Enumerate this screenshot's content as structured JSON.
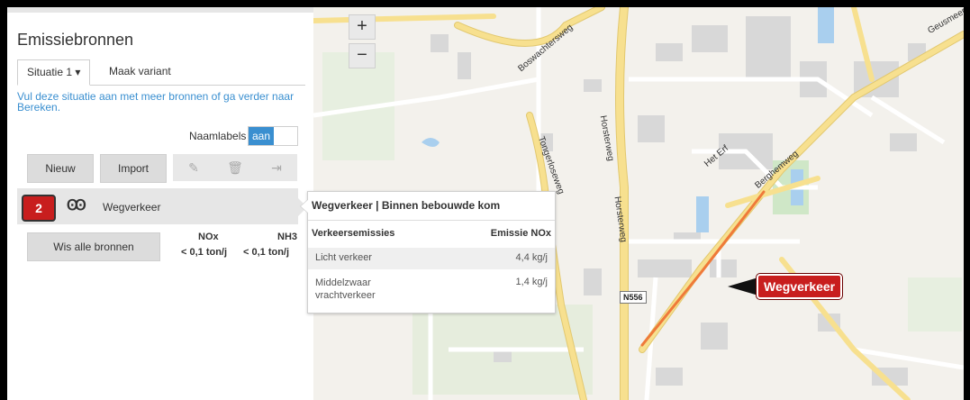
{
  "panel": {
    "title": "Emissiebronnen",
    "tabs": {
      "active": "Situatie 1 ▾",
      "other": "Maak variant"
    },
    "info": "Vul deze situatie aan met meer bronnen of ga verder naar Bereken.",
    "naamlabels": {
      "label": "Naamlabels",
      "toggle": "aan"
    },
    "buttons": {
      "new": "Nieuw",
      "import": "Import",
      "clear_all": "Wis alle bronnen"
    },
    "icons": {
      "edit": "pencil-icon",
      "delete": "trash-icon",
      "copy": "copy-icon"
    },
    "source": {
      "count": "2",
      "icon": "traffic-light-icon",
      "name": "Wegverkeer"
    },
    "totals": {
      "h_nox": "NOx",
      "h_nh3": "NH3",
      "v_nox": "< 0,1 ton/j",
      "v_nh3": "< 0,1 ton/j"
    }
  },
  "popup": {
    "title": "Wegverkeer | Binnen bebouwde kom",
    "col1": "Verkeersemissies",
    "col2": "Emissie NOx",
    "rows": [
      {
        "label": "Licht verkeer",
        "value": "4,4 kg/j"
      },
      {
        "label": "Middelzwaar vrachtverkeer",
        "value": "1,4 kg/j"
      }
    ]
  },
  "map": {
    "zoom_in": "+",
    "zoom_out": "−",
    "streets": [
      "Boswachtersweg",
      "Horsterweg",
      "Horsterweg",
      "Tongerloseweg",
      "Het Erf",
      "Berghemweg",
      "Geusmeer"
    ],
    "road_shield": "N556",
    "callout": "Wegverkeer",
    "colors": {
      "accent": "#3a8fd0",
      "source_red": "#c81e1e",
      "road_yellow": "#f7e08f"
    }
  }
}
